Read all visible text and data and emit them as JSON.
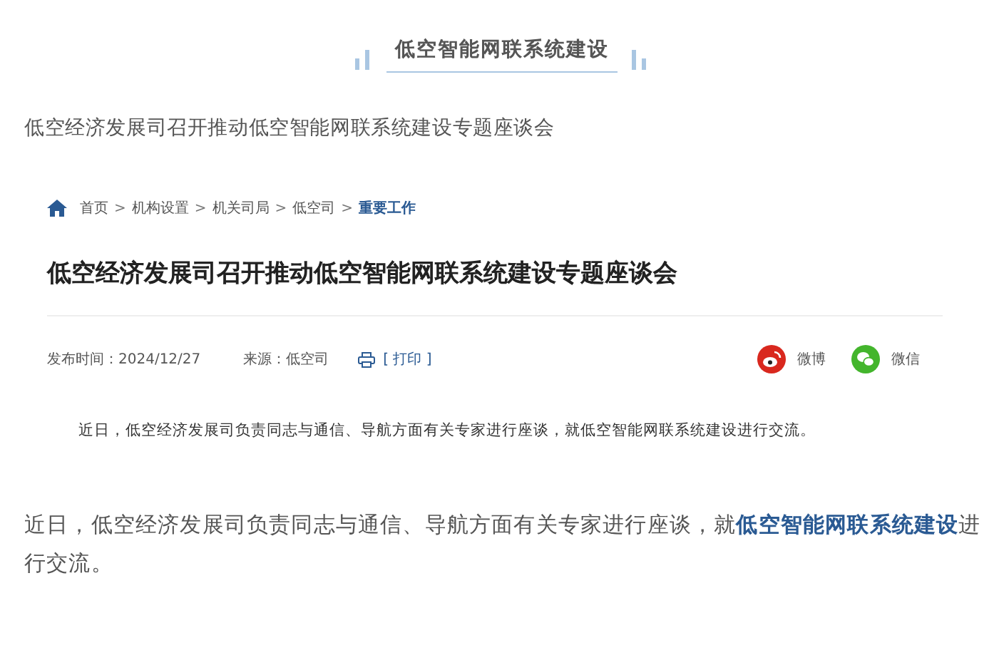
{
  "header": {
    "title": "低空智能网联系统建设"
  },
  "subtitle": "低空经济发展司召开推动低空智能网联系统建设专题座谈会",
  "article": {
    "breadcrumb": {
      "separator": ">",
      "items": [
        {
          "label": "首页",
          "selected": false
        },
        {
          "label": "机构设置",
          "selected": false
        },
        {
          "label": "机关司局",
          "selected": false
        },
        {
          "label": "低空司",
          "selected": false
        },
        {
          "label": "重要工作",
          "selected": true
        }
      ]
    },
    "title": "低空经济发展司召开推动低空智能网联系统建设专题座谈会",
    "published": "发布时间：2024/12/27",
    "source": "来源：低空司",
    "print": "[ 打印 ]",
    "share": [
      {
        "kind": "weibo",
        "label": "微博"
      },
      {
        "kind": "wechat",
        "label": "微信"
      }
    ],
    "body": "近日，低空经济发展司负责同志与通信、导航方面有关专家进行座谈，就低空智能网联系统建设进行交流。"
  },
  "summary": "近日，低空经济发展司负责同志与通信、导航方面有关专家进行座谈，就**低空智能网联系统建设**进行交流。"
}
